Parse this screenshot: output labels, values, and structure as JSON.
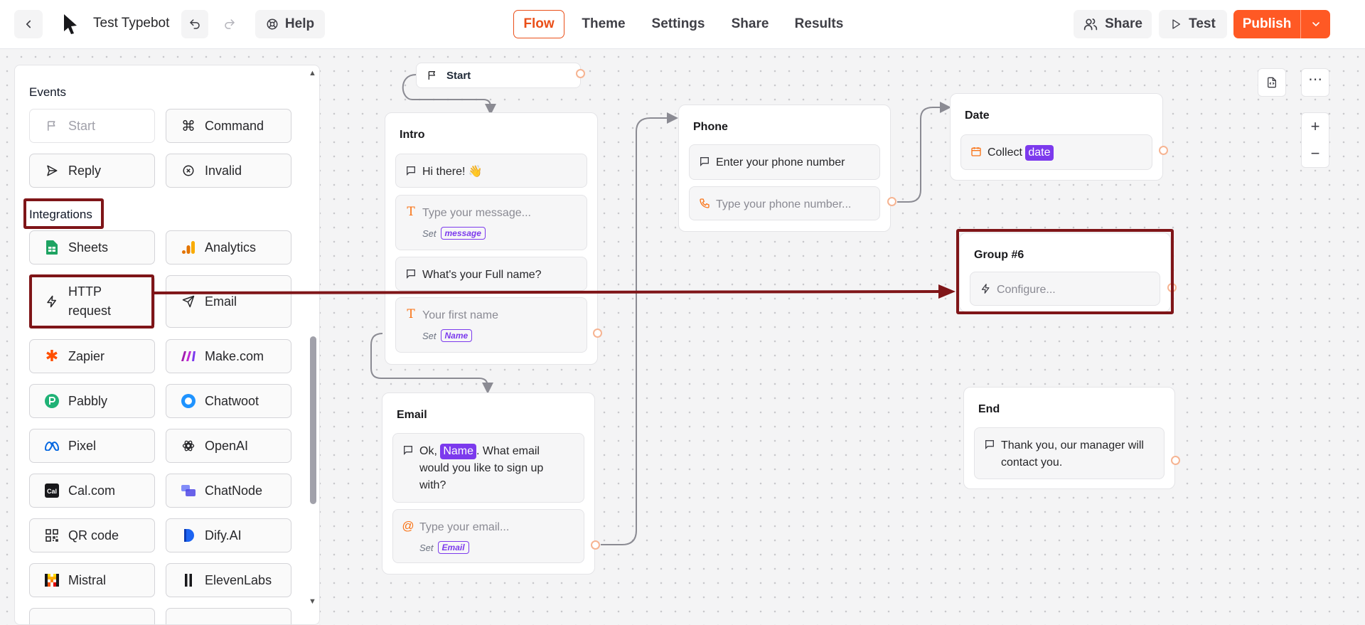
{
  "header": {
    "bot_title": "Test Typebot",
    "help_label": "Help",
    "tabs": [
      {
        "label": "Flow",
        "active": true
      },
      {
        "label": "Theme",
        "active": false
      },
      {
        "label": "Settings",
        "active": false
      },
      {
        "label": "Share",
        "active": false
      },
      {
        "label": "Results",
        "active": false
      }
    ],
    "share_label": "Share",
    "test_label": "Test",
    "publish_label": "Publish",
    "accent_color": "#ff5924"
  },
  "sidebar": {
    "events_heading": "Events",
    "events": [
      {
        "label": "Start",
        "icon": "flag-icon",
        "disabled": true
      },
      {
        "label": "Command",
        "icon": "command-icon"
      },
      {
        "label": "Reply",
        "icon": "send-icon"
      },
      {
        "label": "Invalid",
        "icon": "x-circle-icon"
      }
    ],
    "integrations_heading": "Integrations",
    "integrations": [
      {
        "label": "Sheets",
        "icon": "google-sheets-icon"
      },
      {
        "label": "Analytics",
        "icon": "google-analytics-icon"
      },
      {
        "label": "HTTP request",
        "icon": "lightning-icon"
      },
      {
        "label": "Email",
        "icon": "paper-plane-icon"
      },
      {
        "label": "Zapier",
        "icon": "zapier-icon"
      },
      {
        "label": "Make.com",
        "icon": "make-icon"
      },
      {
        "label": "Pabbly",
        "icon": "pabbly-icon"
      },
      {
        "label": "Chatwoot",
        "icon": "chatwoot-icon"
      },
      {
        "label": "Pixel",
        "icon": "meta-icon"
      },
      {
        "label": "OpenAI",
        "icon": "openai-icon"
      },
      {
        "label": "Cal.com",
        "icon": "calcom-icon"
      },
      {
        "label": "ChatNode",
        "icon": "chatnode-icon"
      },
      {
        "label": "QR code",
        "icon": "qr-code-icon"
      },
      {
        "label": "Dify.AI",
        "icon": "dify-icon"
      },
      {
        "label": "Mistral",
        "icon": "mistral-icon"
      },
      {
        "label": "ElevenLabs",
        "icon": "elevenlabs-icon"
      }
    ]
  },
  "flow": {
    "start_label": "Start",
    "intro": {
      "title": "Intro",
      "msg1": "Hi there! 👋",
      "input1_placeholder": "Type your message...",
      "set_label": "Set",
      "input1_var": "message",
      "msg2": "What's your Full name?",
      "input2_placeholder": "Your first name",
      "input2_var": "Name"
    },
    "email": {
      "title": "Email",
      "msg_prefix": "Ok, ",
      "msg_var": "Name",
      "msg_line1_rest": ". What email",
      "msg_line2": "would you like to sign up",
      "msg_line3": "with?",
      "input_placeholder": "Type your email...",
      "set_label": "Set",
      "input_var": "Email"
    },
    "phone": {
      "title": "Phone",
      "msg": "Enter your phone number",
      "input_placeholder": "Type your phone number..."
    },
    "date": {
      "title": "Date",
      "collect": "Collect",
      "var": "date"
    },
    "group6": {
      "title": "Group #6",
      "placeholder": "Configure..."
    },
    "end": {
      "title": "End",
      "msg_line1": "Thank you, our manager will",
      "msg_line2": "contact you."
    }
  },
  "colors": {
    "variable": "#7c3aed",
    "highlight": "#7f1518",
    "port": "#f6b492"
  }
}
